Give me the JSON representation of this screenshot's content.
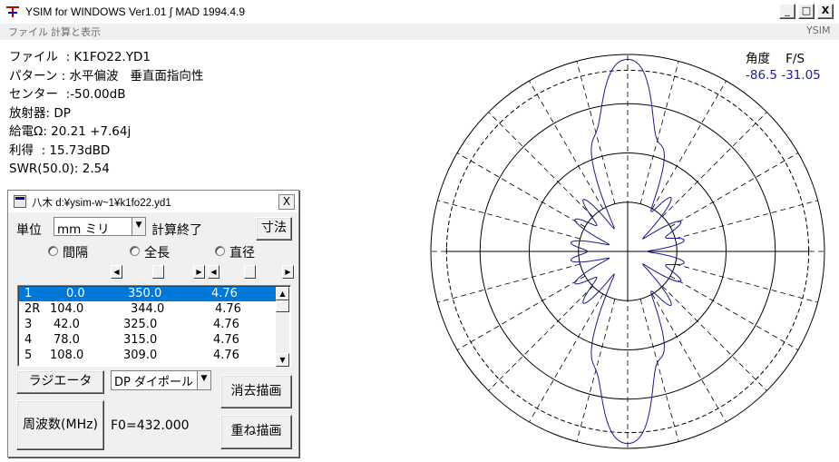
{
  "window": {
    "title": "YSIM for WINDOWS Ver1.01 ∫ MAD 1994.4.9",
    "minimize": "_",
    "maximize": "□",
    "close": "X"
  },
  "menu": {
    "file": "ファイル",
    "calc": "計算と表示",
    "right": "YSIM"
  },
  "info": {
    "file": "ファイル  : K1FO22.YD1",
    "pattern": "パターン : 水平偏波   垂直面指向性",
    "center": "センター  :-50.00dB",
    "radiator": "放射器: DP",
    "feed": "給電Ω: 20.21 +7.64j",
    "gain": "利得  : 15.73dBD",
    "swr": "SWR(50.0): 2.54"
  },
  "readout": {
    "angle_label": "角度",
    "fs_label": "F/S",
    "angle_value": "-86.5",
    "fs_value": "-31.05"
  },
  "dialog": {
    "title": "八木 d:¥ysim-w~1¥k1fo22.yd1",
    "close": "X",
    "unit_label": "単位",
    "unit_value": "mm ミリ",
    "calc_done": "計算終了",
    "dims_button": "寸法",
    "radio_spacing": "間隔",
    "radio_length": "全長",
    "radio_diameter": "直径",
    "rows": [
      {
        "id": "1",
        "pos": "0.0",
        "len": "350.0",
        "dia": "4.76"
      },
      {
        "id": "2R",
        "pos": "104.0",
        "len": "344.0",
        "dia": "4.76"
      },
      {
        "id": "3",
        "pos": "42.0",
        "len": "325.0",
        "dia": "4.76"
      },
      {
        "id": "4",
        "pos": "78.0",
        "len": "315.0",
        "dia": "4.76"
      },
      {
        "id": "5",
        "pos": "108.0",
        "len": "309.0",
        "dia": "4.76"
      }
    ],
    "radiator_button": "ラジエータ",
    "radiator_type": "DP ダイポール",
    "erase_draw": "消去描画",
    "freq_button": "周波数(MHz)",
    "f0": "F0=432.000",
    "overlay_draw": "重ね描画"
  },
  "chart_data": {
    "type": "polar",
    "grid": true,
    "rings": 5,
    "spokes_every_deg": 15,
    "center_db": -50.0,
    "colors": {
      "trace": "#1a1a8c",
      "grid": "#000000"
    }
  }
}
